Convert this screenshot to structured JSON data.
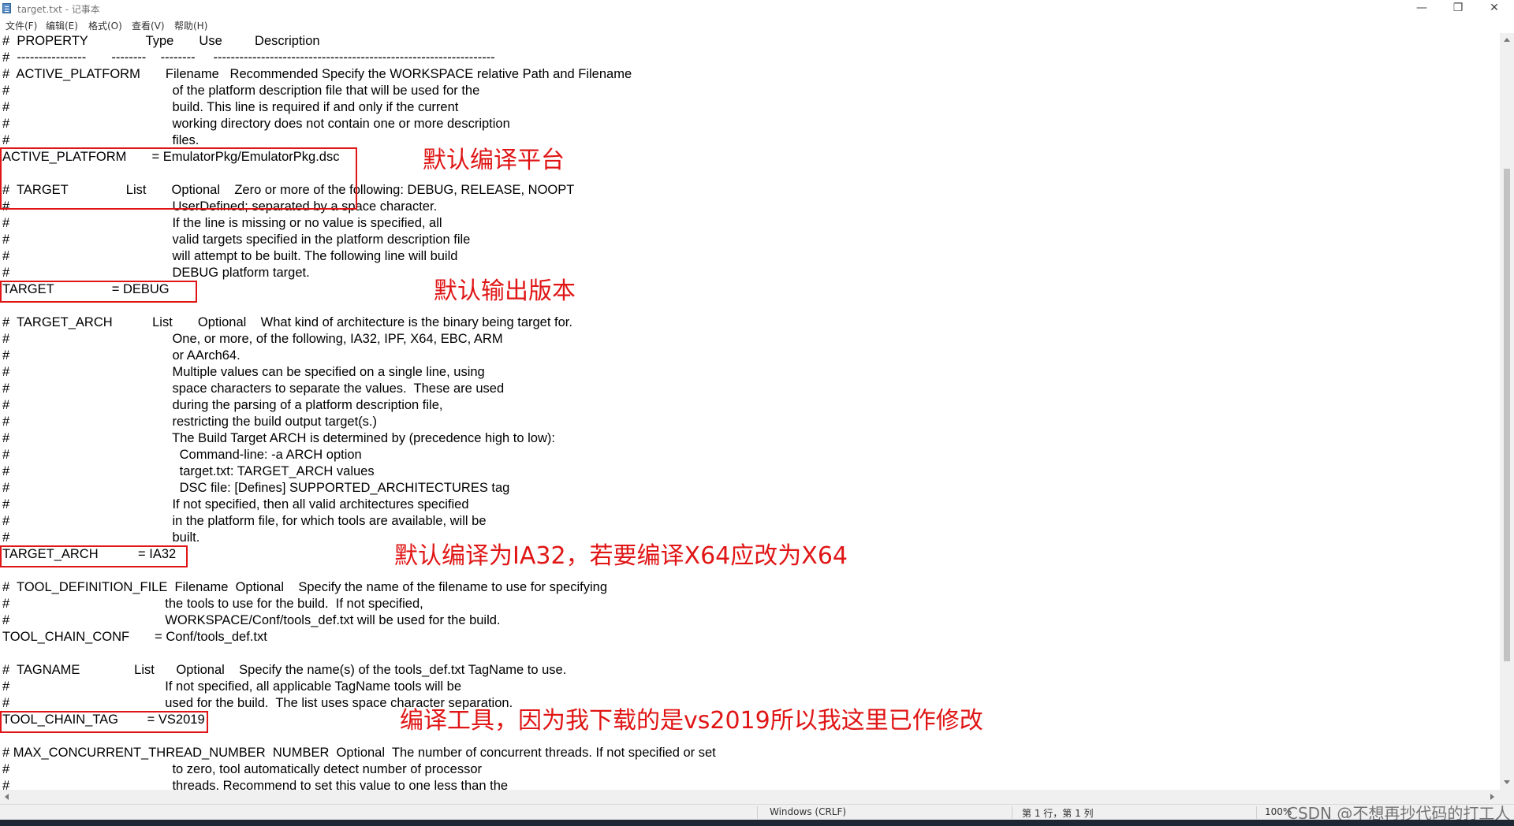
{
  "window": {
    "title": "target.txt - 记事本",
    "controls": {
      "minimize": "—",
      "maximize": "❐",
      "close": "✕"
    }
  },
  "menu": [
    "文件(F)",
    "编辑(E)",
    "格式(O)",
    "查看(V)",
    "帮助(H)"
  ],
  "lines": [
    "#  PROPERTY                Type       Use         Description",
    "#  ----------------       --------    --------     -----------------------------------------------------------------",
    "#  ACTIVE_PLATFORM       Filename   Recommended Specify the WORKSPACE relative Path and Filename",
    "#                                             of the platform description file that will be used for the",
    "#                                             build. This line is required if and only if the current",
    "#                                             working directory does not contain one or more description",
    "#                                             files.",
    "ACTIVE_PLATFORM       = EmulatorPkg/EmulatorPkg.dsc",
    "",
    "#  TARGET                List       Optional    Zero or more of the following: DEBUG, RELEASE, NOOPT",
    "#                                             UserDefined; separated by a space character.",
    "#                                             If the line is missing or no value is specified, all",
    "#                                             valid targets specified in the platform description file",
    "#                                             will attempt to be built. The following line will build",
    "#                                             DEBUG platform target.",
    "TARGET                = DEBUG",
    "",
    "#  TARGET_ARCH           List       Optional    What kind of architecture is the binary being target for.",
    "#                                             One, or more, of the following, IA32, IPF, X64, EBC, ARM",
    "#                                             or AArch64.",
    "#                                             Multiple values can be specified on a single line, using",
    "#                                             space characters to separate the values.  These are used",
    "#                                             during the parsing of a platform description file,",
    "#                                             restricting the build output target(s.)",
    "#                                             The Build Target ARCH is determined by (precedence high to low):",
    "#                                               Command-line: -a ARCH option",
    "#                                               target.txt: TARGET_ARCH values",
    "#                                               DSC file: [Defines] SUPPORTED_ARCHITECTURES tag",
    "#                                             If not specified, then all valid architectures specified",
    "#                                             in the platform file, for which tools are available, will be",
    "#                                             built.",
    "TARGET_ARCH           = IA32",
    "",
    "#  TOOL_DEFINITION_FILE  Filename  Optional    Specify the name of the filename to use for specifying",
    "#                                           the tools to use for the build.  If not specified,",
    "#                                           WORKSPACE/Conf/tools_def.txt will be used for the build.",
    "TOOL_CHAIN_CONF       = Conf/tools_def.txt",
    "",
    "#  TAGNAME               List      Optional    Specify the name(s) of the tools_def.txt TagName to use.",
    "#                                           If not specified, all applicable TagName tools will be",
    "#                                           used for the build.  The list uses space character separation.",
    "TOOL_CHAIN_TAG        = VS2019",
    "",
    "# MAX_CONCURRENT_THREAD_NUMBER  NUMBER  Optional  The number of concurrent threads. If not specified or set",
    "#                                             to zero, tool automatically detect number of processor",
    "#                                             threads. Recommend to set this value to one less than the"
  ],
  "annotations": [
    "默认编译平台",
    "默认输出版本",
    "默认编译为IA32，若要编译X64应改为X64",
    "编译工具，因为我下载的是vs2019所以我这里已作修改"
  ],
  "status": {
    "line_ending": "Windows (CRLF)",
    "position": "第 1 行，第 1 列",
    "zoom": "100%"
  },
  "watermark": "CSDN @不想再抄代码的打工人",
  "colors": {
    "accent": "#e01515",
    "status_bg": "#f0f0f0"
  }
}
